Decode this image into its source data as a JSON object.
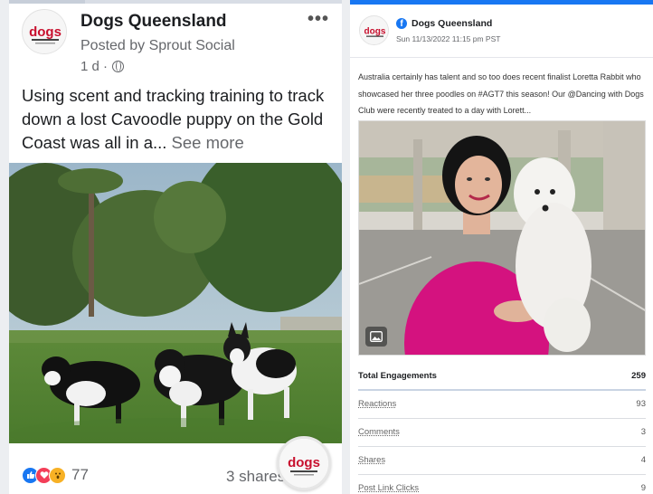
{
  "left_post": {
    "page_name": "Dogs Queensland",
    "posted_by": "Posted by Sprout Social",
    "time": "1 d ·",
    "more_label": "•••",
    "text": "Using scent and tracking training to track down a lost Cavoodle puppy on the Gold Coast was all in a...",
    "see_more": "See more",
    "reaction_count": "77",
    "shares": "3 shares",
    "logo_text": "dogs"
  },
  "right_post": {
    "page_name": "Dogs Queensland",
    "network_icon": "facebook-icon",
    "date": "Sun 11/13/2022 11:15 pm PST",
    "text": "Australia certainly has talent and so too does recent finalist Loretta Rabbit who showcased her three poodles on #AGT7 this season! Our @Dancing with Dogs Club were recently treated to a day with Lorett...",
    "logo_text": "dogs",
    "metrics": [
      {
        "label": "Total Engagements",
        "value": "259"
      },
      {
        "label": "Reactions",
        "value": "93"
      },
      {
        "label": "Comments",
        "value": "3"
      },
      {
        "label": "Shares",
        "value": "4"
      },
      {
        "label": "Post Link Clicks",
        "value": "9"
      }
    ]
  },
  "colors": {
    "facebook_blue": "#1877f2",
    "logo_red": "#c8102e",
    "like_blue": "#1877f2",
    "love_red": "#f33e58",
    "wow_yellow": "#f7b125"
  }
}
